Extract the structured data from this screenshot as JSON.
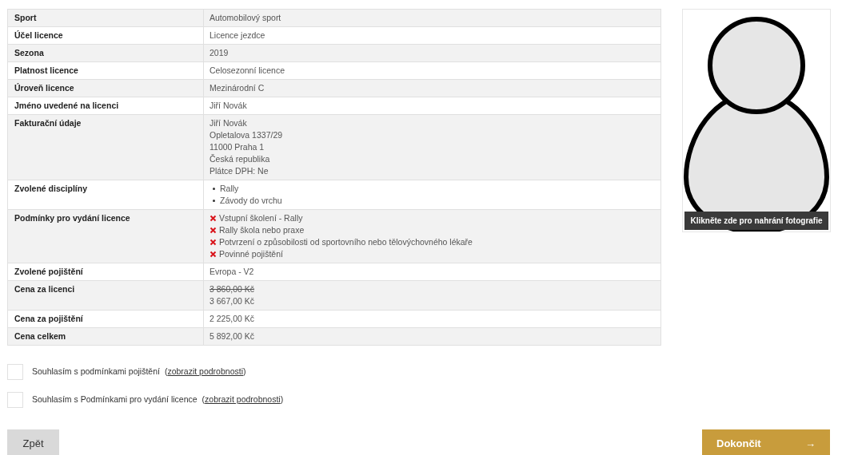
{
  "summary_table": {
    "rows": [
      {
        "label": "Sport",
        "kind": "text",
        "value": "Automobilový sport"
      },
      {
        "label": "Účel licence",
        "kind": "text",
        "value": "Licence jezdce"
      },
      {
        "label": "Sezona",
        "kind": "text",
        "value": "2019"
      },
      {
        "label": "Platnost licence",
        "kind": "text",
        "value": "Celosezonní licence"
      },
      {
        "label": "Úroveň licence",
        "kind": "text",
        "value": "Mezinárodní C"
      },
      {
        "label": "Jméno uvedené na licenci",
        "kind": "text",
        "value": "Jiří Novák"
      },
      {
        "label": "Fakturační údaje",
        "kind": "lines",
        "lines": [
          "Jiří Novák",
          "Opletalova 1337/29",
          "11000 Praha 1",
          "Česká republika",
          "Plátce DPH: Ne"
        ]
      },
      {
        "label": "Zvolené disciplíny",
        "kind": "bullets",
        "items": [
          "Rally",
          "Závody do vrchu"
        ]
      },
      {
        "label": "Podmínky pro vydání licence",
        "kind": "conditions",
        "items": [
          {
            "text": "Vstupní školení - Rally",
            "met": false
          },
          {
            "text": "Rally škola nebo praxe",
            "met": false
          },
          {
            "text": "Potvrzení o způsobilosti od sportovního nebo tělovýchovného lékaře",
            "met": false
          },
          {
            "text": "Povinné pojištění",
            "met": false
          }
        ]
      },
      {
        "label": "Zvolené pojištění",
        "kind": "text",
        "value": "Evropa - V2"
      },
      {
        "label": "Cena za licenci",
        "kind": "price",
        "old": "3 860,00 Kč",
        "value": "3 667,00 Kč"
      },
      {
        "label": "Cena za pojištění",
        "kind": "text",
        "value": "2 225,00 Kč"
      },
      {
        "label": "Cena celkem",
        "kind": "text",
        "value": "5 892,00 Kč"
      }
    ]
  },
  "photo": {
    "upload_caption": "Klikněte zde pro nahrání fotografie"
  },
  "agreements": [
    {
      "text": "Souhlasím s podmínkami pojištění",
      "open": "(",
      "link": "zobrazit podrobnosti",
      "close": ")",
      "checked": false
    },
    {
      "text": "Souhlasím s Podmínkami pro vydání licence",
      "open": "(",
      "link": "zobrazit podrobnosti",
      "close": ")",
      "checked": false
    }
  ],
  "buttons": {
    "back": "Zpět",
    "finish": "Dokončit",
    "finish_icon": "→"
  }
}
